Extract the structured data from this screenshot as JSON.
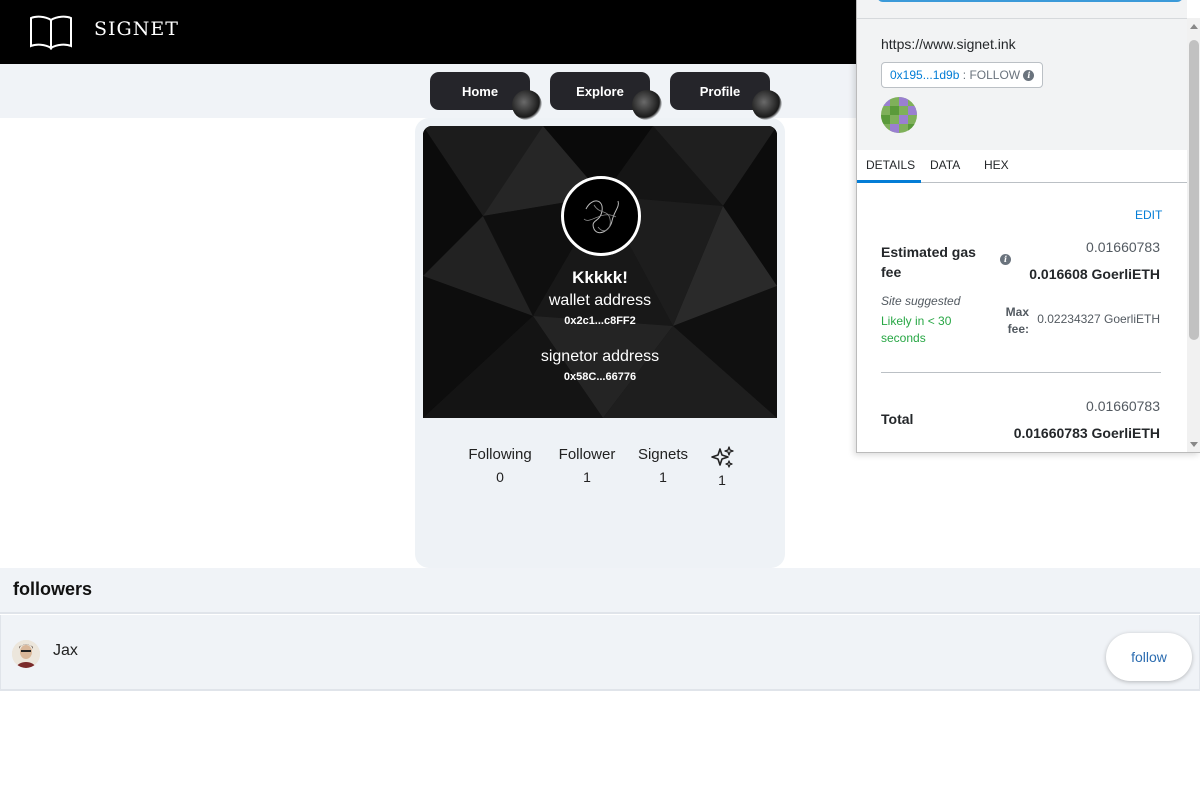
{
  "header": {
    "logo_text": "SIGNET",
    "logo_icon": "open-book-icon"
  },
  "nav": {
    "items": [
      {
        "label": "Home"
      },
      {
        "label": "Explore"
      },
      {
        "label": "Profile"
      }
    ]
  },
  "profile": {
    "name": "Kkkkk!",
    "wallet_label": "wallet address",
    "wallet_address": "0x2c1...c8FF2",
    "signetor_label": "signetor address",
    "signetor_address": "0x58C...66776",
    "stats": [
      {
        "label": "Following",
        "value": "0"
      },
      {
        "label": "Follower",
        "value": "1"
      },
      {
        "label": "Signets",
        "value": "1"
      },
      {
        "icon": "sparkles-icon",
        "value": "1"
      }
    ]
  },
  "followers": {
    "title": "followers",
    "items": [
      {
        "name": "Jax",
        "button_label": "follow"
      }
    ]
  },
  "wallet_popup": {
    "origin": "https://www.signet.ink",
    "contract_address": "0x195...1d9b",
    "method_separator": ":",
    "method": "FOLLOW",
    "tabs": [
      {
        "label": "DETAILS"
      },
      {
        "label": "DATA"
      },
      {
        "label": "HEX"
      }
    ],
    "edit_label": "EDIT",
    "gas_label": "Estimated gas fee",
    "gas_secondary": "0.01660783",
    "gas_primary": "0.016608 GoerliETH",
    "site_suggested": "Site suggested",
    "likely": "Likely in < 30 seconds",
    "max_fee_label": "Max fee:",
    "max_fee_value": "0.02234327 GoerliETH",
    "total_label": "Total",
    "total_secondary": "0.01660783",
    "total_primary": "0.01660783 GoerliETH"
  },
  "colors": {
    "accent_blue": "#037dd6",
    "success_green": "#28a745",
    "header_bg": "#000000",
    "nav_button_bg": "#25252a"
  }
}
